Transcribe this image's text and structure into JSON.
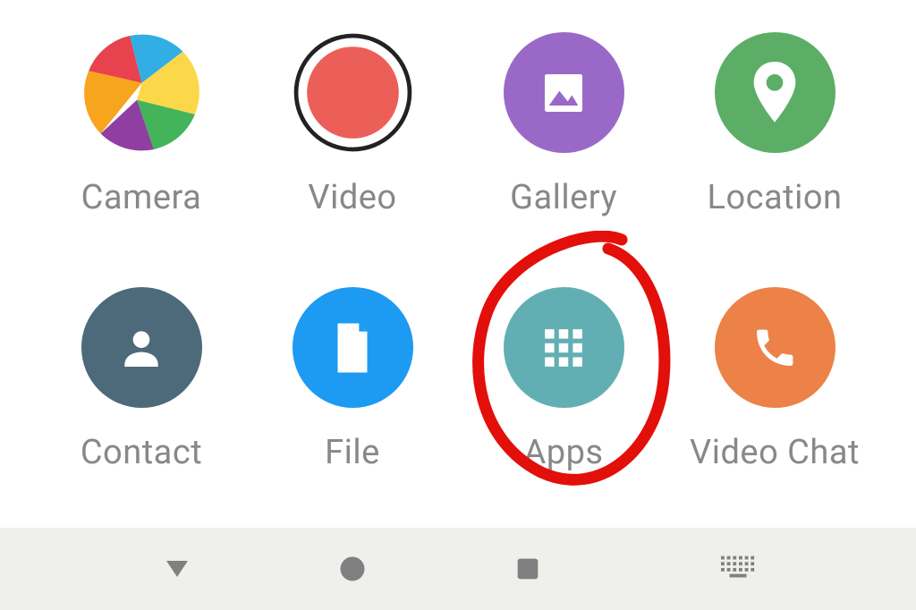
{
  "grid": {
    "items": [
      {
        "id": "camera",
        "label": "Camera",
        "icon": "camera-shutter-icon",
        "bg": "#ffffff"
      },
      {
        "id": "video",
        "label": "Video",
        "icon": "record-icon",
        "bg": "#ffffff"
      },
      {
        "id": "gallery",
        "label": "Gallery",
        "icon": "image-icon",
        "bg": "#9a69c8"
      },
      {
        "id": "location",
        "label": "Location",
        "icon": "pin-icon",
        "bg": "#5cae67"
      },
      {
        "id": "contact",
        "label": "Contact",
        "icon": "person-icon",
        "bg": "#4d6a7a"
      },
      {
        "id": "file",
        "label": "File",
        "icon": "file-icon",
        "bg": "#1d9af1"
      },
      {
        "id": "apps",
        "label": "Apps",
        "icon": "apps-grid-icon",
        "bg": "#62afb3"
      },
      {
        "id": "videochat",
        "label": "Video Chat",
        "icon": "phone-icon",
        "bg": "#ec8247"
      }
    ]
  },
  "navbar": {
    "buttons": [
      {
        "id": "back",
        "icon": "nav-back-triangle-icon"
      },
      {
        "id": "home",
        "icon": "nav-home-circle-icon"
      },
      {
        "id": "recent",
        "icon": "nav-recent-square-icon"
      },
      {
        "id": "keyboard",
        "icon": "nav-keyboard-icon"
      }
    ]
  },
  "annotation": {
    "present": true,
    "target": "apps",
    "color": "#e30f0a"
  }
}
